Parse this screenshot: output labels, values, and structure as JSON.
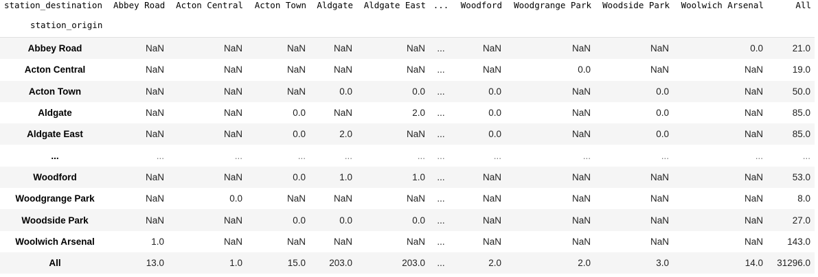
{
  "table": {
    "column_index_name": "station_destination",
    "row_index_name": "station_origin",
    "columns": [
      "Abbey Road",
      "Acton Central",
      "Acton Town",
      "Aldgate",
      "Aldgate East",
      "...",
      "Woodford",
      "Woodgrange Park",
      "Woodside Park",
      "Woolwich Arsenal",
      "All"
    ],
    "rows": [
      {
        "label": "Abbey Road",
        "cells": [
          "NaN",
          "NaN",
          "NaN",
          "NaN",
          "NaN",
          "...",
          "NaN",
          "NaN",
          "NaN",
          "0.0",
          "21.0"
        ]
      },
      {
        "label": "Acton Central",
        "cells": [
          "NaN",
          "NaN",
          "NaN",
          "NaN",
          "NaN",
          "...",
          "NaN",
          "0.0",
          "NaN",
          "NaN",
          "19.0"
        ]
      },
      {
        "label": "Acton Town",
        "cells": [
          "NaN",
          "NaN",
          "NaN",
          "0.0",
          "0.0",
          "...",
          "0.0",
          "NaN",
          "0.0",
          "NaN",
          "50.0"
        ]
      },
      {
        "label": "Aldgate",
        "cells": [
          "NaN",
          "NaN",
          "0.0",
          "NaN",
          "2.0",
          "...",
          "0.0",
          "NaN",
          "0.0",
          "NaN",
          "85.0"
        ]
      },
      {
        "label": "Aldgate East",
        "cells": [
          "NaN",
          "NaN",
          "0.0",
          "2.0",
          "NaN",
          "...",
          "0.0",
          "NaN",
          "0.0",
          "NaN",
          "85.0"
        ]
      },
      {
        "label": "...",
        "cells": [
          "...",
          "...",
          "...",
          "...",
          "...",
          "...",
          "...",
          "...",
          "...",
          "...",
          "..."
        ]
      },
      {
        "label": "Woodford",
        "cells": [
          "NaN",
          "NaN",
          "0.0",
          "1.0",
          "1.0",
          "...",
          "NaN",
          "NaN",
          "NaN",
          "NaN",
          "53.0"
        ]
      },
      {
        "label": "Woodgrange Park",
        "cells": [
          "NaN",
          "0.0",
          "NaN",
          "NaN",
          "NaN",
          "...",
          "NaN",
          "NaN",
          "NaN",
          "NaN",
          "8.0"
        ]
      },
      {
        "label": "Woodside Park",
        "cells": [
          "NaN",
          "NaN",
          "0.0",
          "0.0",
          "0.0",
          "...",
          "NaN",
          "NaN",
          "NaN",
          "NaN",
          "27.0"
        ]
      },
      {
        "label": "Woolwich Arsenal",
        "cells": [
          "1.0",
          "NaN",
          "NaN",
          "NaN",
          "NaN",
          "...",
          "NaN",
          "NaN",
          "NaN",
          "NaN",
          "143.0"
        ]
      },
      {
        "label": "All",
        "cells": [
          "13.0",
          "1.0",
          "15.0",
          "203.0",
          "203.0",
          "...",
          "2.0",
          "2.0",
          "3.0",
          "14.0",
          "31296.0"
        ]
      }
    ]
  }
}
